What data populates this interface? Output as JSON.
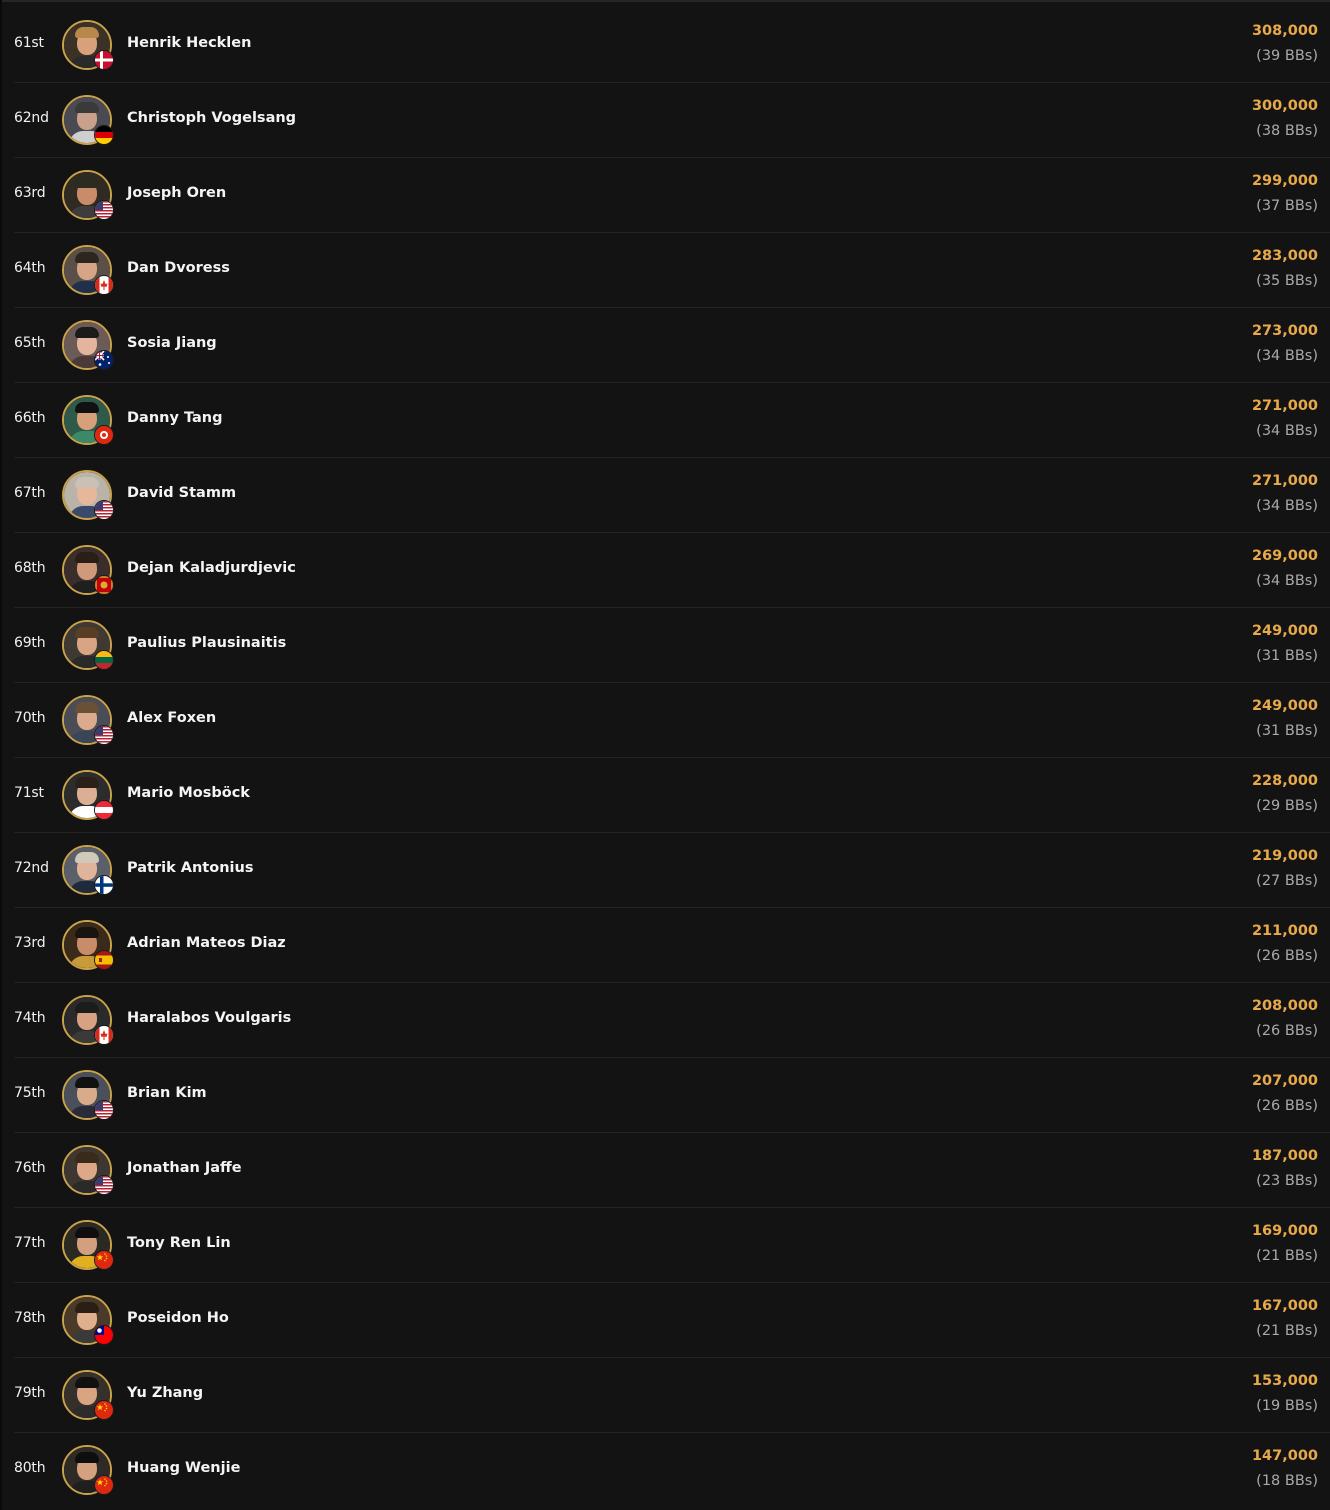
{
  "players": [
    {
      "rank": "61st",
      "name": "Henrik Hecklen",
      "chips": "308,000",
      "bbs": "(39 BBs)",
      "flag": "denmark"
    },
    {
      "rank": "62nd",
      "name": "Christoph Vogelsang",
      "chips": "300,000",
      "bbs": "(38 BBs)",
      "flag": "germany"
    },
    {
      "rank": "63rd",
      "name": "Joseph Oren",
      "chips": "299,000",
      "bbs": "(37 BBs)",
      "flag": "usa"
    },
    {
      "rank": "64th",
      "name": "Dan Dvoress",
      "chips": "283,000",
      "bbs": "(35 BBs)",
      "flag": "canada"
    },
    {
      "rank": "65th",
      "name": "Sosia Jiang",
      "chips": "273,000",
      "bbs": "(34 BBs)",
      "flag": "australia"
    },
    {
      "rank": "66th",
      "name": "Danny Tang",
      "chips": "271,000",
      "bbs": "(34 BBs)",
      "flag": "hongkong"
    },
    {
      "rank": "67th",
      "name": "David Stamm",
      "chips": "271,000",
      "bbs": "(34 BBs)",
      "flag": "usa"
    },
    {
      "rank": "68th",
      "name": "Dejan Kaladjurdjevic",
      "chips": "269,000",
      "bbs": "(34 BBs)",
      "flag": "montenegro"
    },
    {
      "rank": "69th",
      "name": "Paulius Plausinaitis",
      "chips": "249,000",
      "bbs": "(31 BBs)",
      "flag": "lithuania"
    },
    {
      "rank": "70th",
      "name": "Alex Foxen",
      "chips": "249,000",
      "bbs": "(31 BBs)",
      "flag": "usa"
    },
    {
      "rank": "71st",
      "name": "Mario Mosböck",
      "chips": "228,000",
      "bbs": "(29 BBs)",
      "flag": "austria"
    },
    {
      "rank": "72nd",
      "name": "Patrik Antonius",
      "chips": "219,000",
      "bbs": "(27 BBs)",
      "flag": "finland"
    },
    {
      "rank": "73rd",
      "name": "Adrian Mateos Diaz",
      "chips": "211,000",
      "bbs": "(26 BBs)",
      "flag": "spain"
    },
    {
      "rank": "74th",
      "name": "Haralabos Voulgaris",
      "chips": "208,000",
      "bbs": "(26 BBs)",
      "flag": "canada"
    },
    {
      "rank": "75th",
      "name": "Brian Kim",
      "chips": "207,000",
      "bbs": "(26 BBs)",
      "flag": "usa"
    },
    {
      "rank": "76th",
      "name": "Jonathan Jaffe",
      "chips": "187,000",
      "bbs": "(23 BBs)",
      "flag": "usa"
    },
    {
      "rank": "77th",
      "name": "Tony Ren Lin",
      "chips": "169,000",
      "bbs": "(21 BBs)",
      "flag": "china"
    },
    {
      "rank": "78th",
      "name": "Poseidon Ho",
      "chips": "167,000",
      "bbs": "(21 BBs)",
      "flag": "taiwan"
    },
    {
      "rank": "79th",
      "name": "Yu Zhang",
      "chips": "153,000",
      "bbs": "(19 BBs)",
      "flag": "china"
    },
    {
      "rank": "80th",
      "name": "Huang Wenjie",
      "chips": "147,000",
      "bbs": "(18 BBs)",
      "flag": "china"
    }
  ],
  "colors": {
    "background": "#131313",
    "chips": "#e8a94a",
    "bbs": "#a9a9a9",
    "avatar_ring": "#c9a24a"
  }
}
